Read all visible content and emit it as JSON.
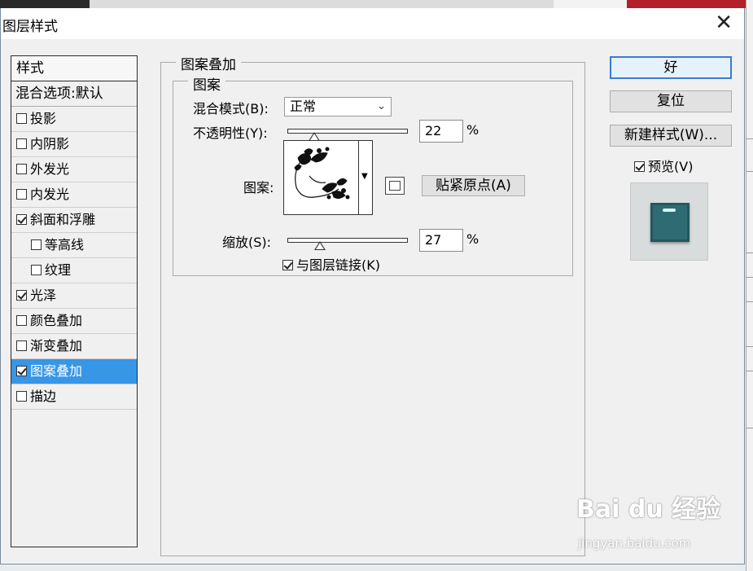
{
  "dialog": {
    "title": "图层样式",
    "close_glyph": "✕"
  },
  "style_list": {
    "header": "样式",
    "blend_options": "混合选项:默认",
    "items": [
      {
        "label": "投影",
        "checked": false,
        "indent": false
      },
      {
        "label": "内阴影",
        "checked": false,
        "indent": false
      },
      {
        "label": "外发光",
        "checked": false,
        "indent": false
      },
      {
        "label": "内发光",
        "checked": false,
        "indent": false
      },
      {
        "label": "斜面和浮雕",
        "checked": true,
        "indent": false
      },
      {
        "label": "等高线",
        "checked": false,
        "indent": true
      },
      {
        "label": "纹理",
        "checked": false,
        "indent": true
      },
      {
        "label": "光泽",
        "checked": true,
        "indent": false
      },
      {
        "label": "颜色叠加",
        "checked": false,
        "indent": false
      },
      {
        "label": "渐变叠加",
        "checked": false,
        "indent": false
      },
      {
        "label": "图案叠加",
        "checked": true,
        "indent": false,
        "active": true
      },
      {
        "label": "描边",
        "checked": false,
        "indent": false
      }
    ]
  },
  "panel": {
    "outer_legend": "图案叠加",
    "inner_legend": "图案",
    "blend_mode_label": "混合模式(B):",
    "blend_mode_value": "正常",
    "opacity_label": "不透明性(Y):",
    "opacity_value": "22",
    "opacity_percent": 22,
    "percent_sign": "%",
    "pattern_label": "图案:",
    "snap_origin_button": "贴紧原点(A)",
    "scale_label": "缩放(S):",
    "scale_value": "27",
    "scale_percent": 27,
    "link_label": "与图层链接(K)",
    "link_checked": true
  },
  "buttons": {
    "ok": "好",
    "reset": "复位",
    "new_style": "新建样式(W)...",
    "preview_label": "预览(V)",
    "preview_checked": true
  },
  "watermark": {
    "brand": "Bai du 经验",
    "url": "jingyan.baidu.com"
  }
}
